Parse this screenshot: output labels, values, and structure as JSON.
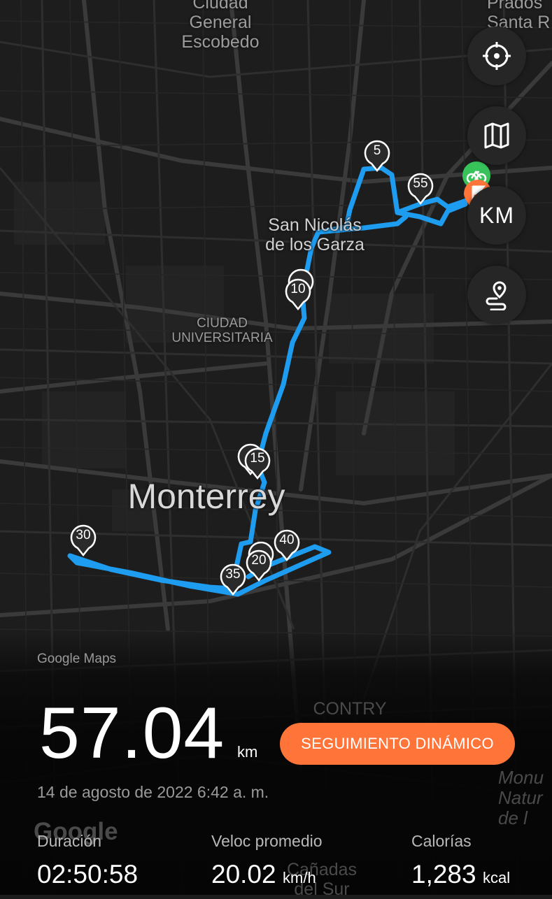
{
  "map": {
    "places": {
      "escobedo": "Ciudad\nGeneral\nEscobedo",
      "prados": "Prados\nSanta R",
      "san_nicolas": "San Nicolás\nde los Garza",
      "ciudad_universitaria": "CIUDAD\nUNIVERSITARIA",
      "monterrey": "Monterrey",
      "contry": "CONTRY",
      "monumento": "Monu\nNatur\nde l",
      "canadas": "Cañadas\ndel Sur",
      "google_watermark": "Google"
    },
    "km_markers": [
      "5",
      "10",
      "15",
      "20",
      "30",
      "35",
      "40",
      "55"
    ],
    "controls": {
      "locate_icon": "crosshair-icon",
      "map_type_icon": "map-icon",
      "km_toggle": "KM",
      "route_icon": "route-icon"
    },
    "colors": {
      "route": "#1e9cf0",
      "start": "#37c25a",
      "end": "#ff7438"
    }
  },
  "summary": {
    "attribution": "Google Maps",
    "distance": "57.04",
    "distance_unit": "km",
    "dynamic_button": "SEGUIMIENTO DINÁMICO",
    "date": "14 de agosto de 2022 6:42 a. m.",
    "stats": [
      {
        "label": "Duración",
        "value": "02:50:58",
        "unit": ""
      },
      {
        "label": "Veloc promedio",
        "value": "20.02",
        "unit": "km/h"
      },
      {
        "label": "Calorías",
        "value": "1,283",
        "unit": "kcal"
      }
    ]
  }
}
